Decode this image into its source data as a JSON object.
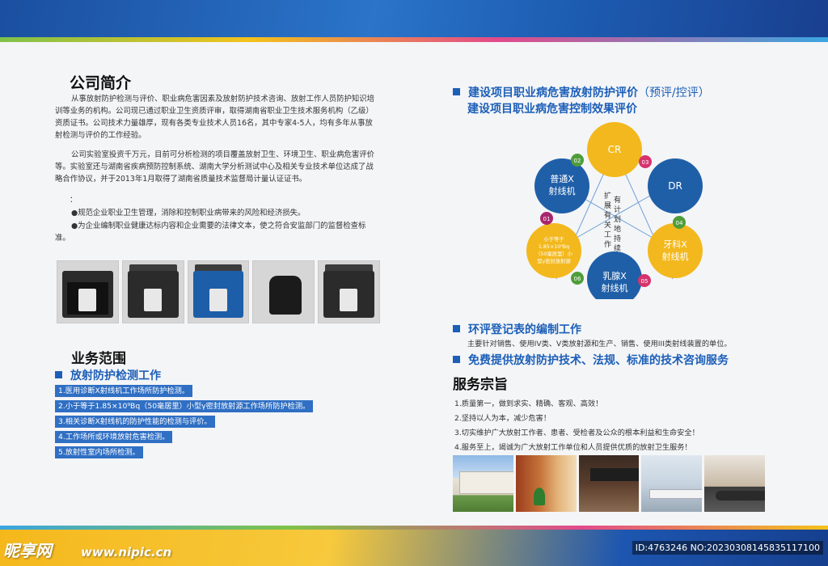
{
  "company": {
    "title": "公司简介",
    "para1": "从事放射防护检测与评价、职业病危害因素及放射防护技术咨询、放射工作人员防护知识培训等业务的机构。公司现已通过职业卫生资质评审，取得湖南省职业卫生技术服务机构（乙级）资质证书。公司技术力量雄厚，现有各类专业技术人员16名，其中专家4-5人，均有多年从事放射检测与评价的工作经验。",
    "para2": "公司实验室投资千万元，目前可分析检测的项目覆盖放射卫生、环境卫生、职业病危害评价等。实验室还与湖南省疾病预防控制系统、湖南大学分析测试中心及相关专业技术单位达成了战略合作协议，并于2013年1月取得了湖南省质量技术监督局计量认证证书。",
    "colon": "：",
    "bullet1": "●规范企业职业卫生管理，消除和控制职业病带来的风险和经济损失。",
    "bullet2": "●为企业编制职业健康达标内容和企业需要的法律文本，使之符合安监部门的监督检查标准。"
  },
  "business": {
    "title": "业务范围",
    "subheading": "放射防护检测工作",
    "items": [
      "1.医用诊断X射线机工作场所防护检测。",
      "2.小于等于1.85×10⁹Bq（50毫居里）小型γ密封放射源工作场所防护检测。",
      "3.相关诊断X射线机的防护性能的检测与评价。",
      "4.工作场所或环境放射危害检测。",
      "5.放射性室内场所检测。"
    ]
  },
  "evaluation": {
    "heading_line1_main": "建设项目职业病危害放射防护评价",
    "heading_line1_light": "（预评/控评）",
    "heading_line2": "建设项目职业病危害控制效果评价"
  },
  "diagram": {
    "center_text": "扩有展计有划关地工持作续",
    "nodes": {
      "cr": "CR",
      "xray": "普通X射线机",
      "dr": "DR",
      "dental": "牙科X射线机",
      "mammo": "乳腺X射线机",
      "gamma": "小于等于1.85×10⁹Bq（50毫居里）小型γ密封放射源"
    },
    "numbers": [
      "01",
      "02",
      "03",
      "04",
      "05",
      "06"
    ],
    "colors": {
      "yellow": "#f3b81d",
      "blue": "#1f5fa8",
      "green": "#4f9d3a",
      "pink": "#d6336c",
      "magenta": "#a8266e",
      "line": "#6fa0d8"
    }
  },
  "environment": {
    "heading": "环评登记表的编制工作",
    "text": "主要针对销售、使用IV类、V类放射源和生产、销售、使用III类射线装置的单位。"
  },
  "consulting": {
    "heading": "免费提供放射防护技术、法规、标准的技术咨询服务"
  },
  "purpose": {
    "title": "服务宗旨",
    "items": [
      "1.质量第一，做到求实、精确、客观、高效！",
      "2.坚持以人为本，减少危害！",
      "3.切实维护广大放射工作者、患者、受检者及公众的根本利益和生命安全！",
      "4.服务至上，竭诚为广大放射工作单位和人员提供优质的放射卫生服务！"
    ]
  },
  "watermark": {
    "logo": "昵享网",
    "url": "www.nipic.cn",
    "id": "ID:4763246 NO:20230308145835117100"
  }
}
